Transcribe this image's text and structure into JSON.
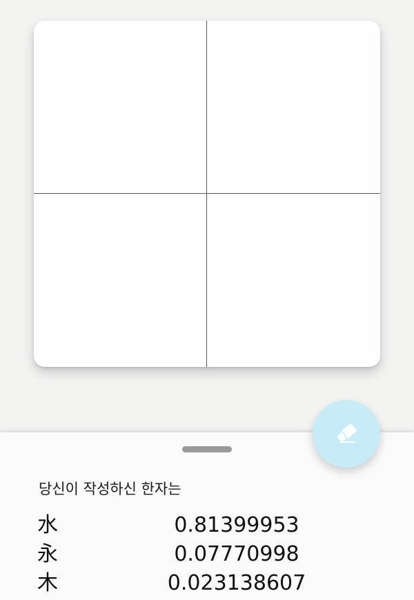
{
  "drawing_canvas": {
    "label": ""
  },
  "clear_button": {
    "icon": "eraser-icon"
  },
  "results_sheet": {
    "title": "당신이 작성하신 한자는",
    "results": [
      {
        "character": "水",
        "probability": "0.81399953"
      },
      {
        "character": "永",
        "probability": "0.07770998"
      },
      {
        "character": "木",
        "probability": "0.023138607"
      }
    ]
  },
  "colors": {
    "background": "#f3f3f2",
    "canvas": "#fdfefd",
    "fab": "#c7ecf7",
    "handle": "#9a9a9a"
  }
}
